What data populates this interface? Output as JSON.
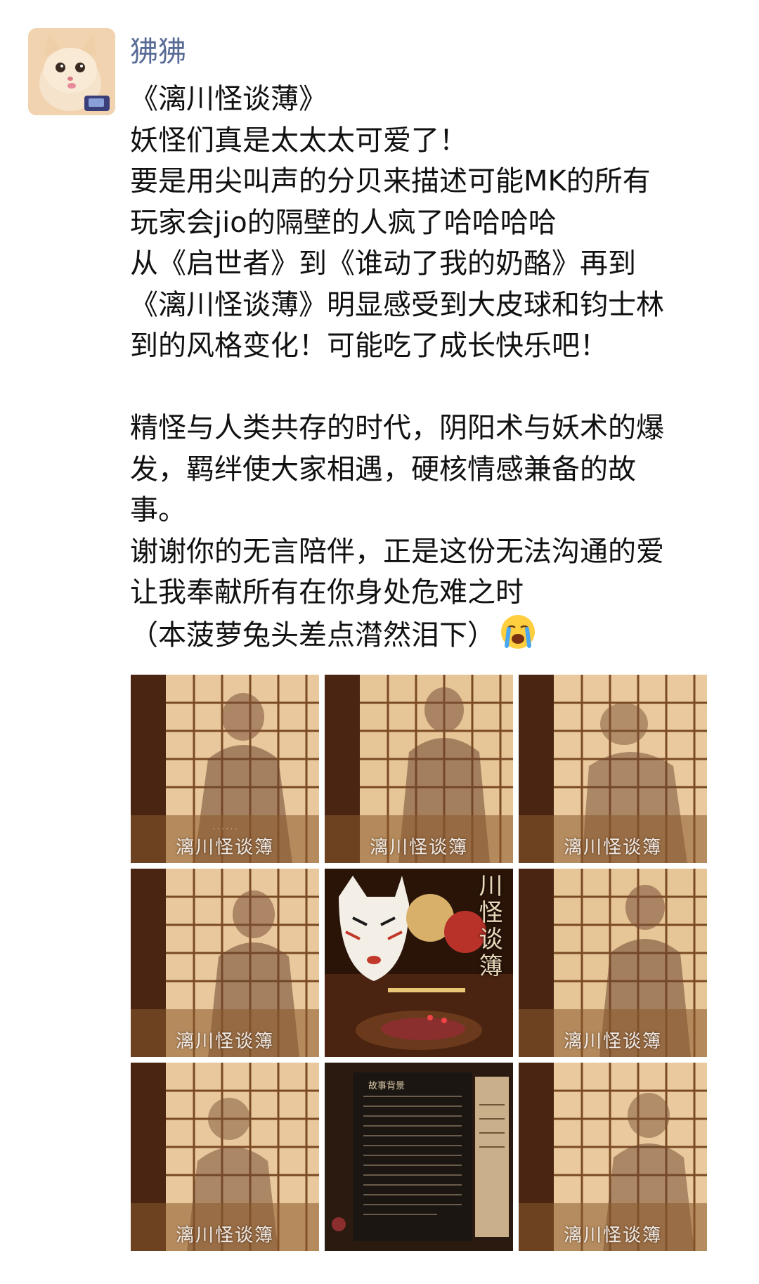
{
  "user": {
    "name": "狒狒",
    "avatar_icon": "cat-avatar"
  },
  "post": {
    "lines": [
      "《漓川怪谈薄》",
      "妖怪们真是太太太可爱了！",
      "要是用尖叫声的分贝来描述可能MK的所有",
      "玩家会jio的隔壁的人疯了哈哈哈哈",
      "从《启世者》到《谁动了我的奶酪》再到",
      "《漓川怪谈薄》明显感受到大皮球和钧士林",
      "到的风格变化！可能吃了成长快乐吧！",
      "",
      "精怪与人类共存的时代，阴阳术与妖术的爆",
      "发，羁绊使大家相遇，硬核情感兼备的故",
      "事。",
      "谢谢你的无言陪伴，正是这份无法沟通的爱",
      "让我奉献所有在你身处危难之时",
      "（本菠萝兔头差点潸然泪下）"
    ],
    "emoji": "crying-face-icon"
  },
  "images": {
    "shadow_caption": "漓川怪谈簿",
    "poster_title": "川怪谈簿",
    "doc_title": "故事背景",
    "items": [
      {
        "kind": "shadow"
      },
      {
        "kind": "shadow"
      },
      {
        "kind": "shadow"
      },
      {
        "kind": "shadow"
      },
      {
        "kind": "poster"
      },
      {
        "kind": "shadow"
      },
      {
        "kind": "shadow"
      },
      {
        "kind": "document"
      },
      {
        "kind": "shadow"
      }
    ]
  },
  "colors": {
    "username": "#576b95",
    "text": "#111111"
  }
}
